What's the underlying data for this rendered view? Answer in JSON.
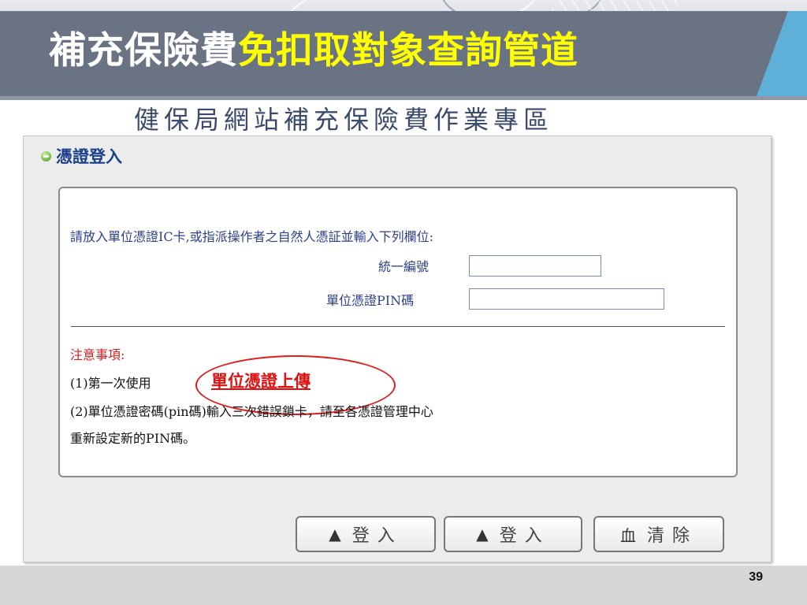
{
  "slide": {
    "title_part1": "補充保險費",
    "title_part2": "免扣取對象查詢管道",
    "subtitle": "健保局網站補充保險費作業專區",
    "page_number": "39"
  },
  "login_panel": {
    "title": "憑證登入",
    "instruction": "請放入單位憑證IC卡,或指派操作者之自然人憑証並輸入下列欄位:",
    "fields": [
      {
        "label": "統一編號",
        "value": "",
        "placeholder": ""
      },
      {
        "label": "單位憑證PIN碼",
        "value": "",
        "placeholder": ""
      }
    ],
    "notes": {
      "heading": "注意事項:",
      "line1_prefix": "(1)第一次使用",
      "upload_link": "單位憑證上傳",
      "line2": "(2)單位憑證密碼(pin碼)輸入三次錯誤鎖卡，請至各憑證管理中心",
      "line3": "重新設定新的PIN碼。"
    },
    "buttons": [
      {
        "icon": "▲",
        "label": "登入"
      },
      {
        "icon": "▲",
        "label": "登入"
      },
      {
        "icon": "⾎",
        "label": "清除"
      }
    ]
  },
  "colors": {
    "title_white": "#ffffff",
    "title_yellow": "#ffff00",
    "link_red": "#e01010",
    "label_blue": "#2b3f8c"
  }
}
